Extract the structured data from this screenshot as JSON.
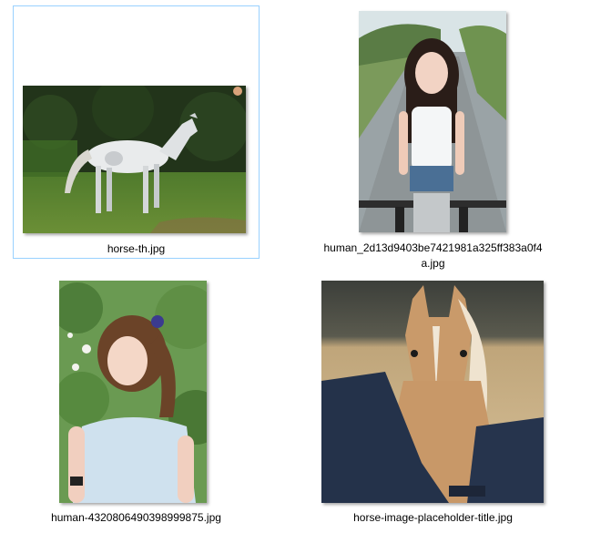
{
  "view": "large-icons",
  "files": [
    {
      "name": "horse-th.jpg",
      "selected": true,
      "thumbnail": "white-horse-on-grass"
    },
    {
      "name": "human_2d13d9403be7421981a325ff383a0f4a.jpg",
      "name_line1": "human_2d13d9403be7421981a325ff383a0f4",
      "name_line2": "a.jpg",
      "selected": false,
      "thumbnail": "girl-with-bicycle-on-road"
    },
    {
      "name": "human-4320806490398999875.jpg",
      "selected": false,
      "thumbnail": "girl-in-garden"
    },
    {
      "name": "horse-image-placeholder-title.jpg",
      "selected": false,
      "thumbnail": "palomino-horse-with-blanket"
    }
  ],
  "colors": {
    "selection_border": "#99d1ff",
    "background": "#ffffff",
    "text": "#000000"
  }
}
